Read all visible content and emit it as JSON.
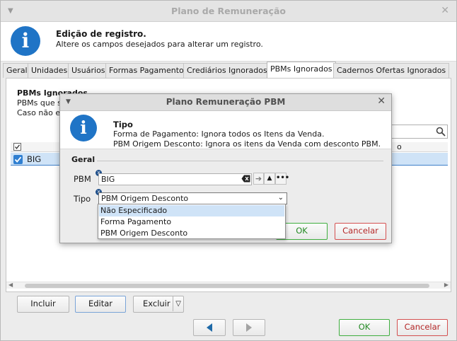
{
  "window": {
    "title": "Plano de Remuneração",
    "menu_glyph": "▼",
    "close_glyph": "✕",
    "header": {
      "icon": "info-icon",
      "icon_glyph": "i",
      "title": "Edição de registro.",
      "subtitle": "Altere os campos desejados para alterar um registro."
    }
  },
  "tabs": [
    {
      "label": "Geral",
      "active": false
    },
    {
      "label": "Unidades",
      "active": false
    },
    {
      "label": "Usuários",
      "active": false
    },
    {
      "label": "Formas Pagamento",
      "active": false
    },
    {
      "label": "Crediários Ignorados",
      "active": false
    },
    {
      "label": "PBMs Ignorados",
      "active": true
    },
    {
      "label": "Cadernos Ofertas Ignorados",
      "active": false
    }
  ],
  "panel": {
    "heading": "PBMs Ignorados",
    "line1": "PBMs que s",
    "line2": "Caso não es",
    "search_icon": "search-icon",
    "column_header_fragment": "o",
    "rows": [
      {
        "checked": true,
        "value": "BIG"
      }
    ]
  },
  "bottom_buttons": {
    "incluir": "Incluir",
    "editar": "Editar",
    "excluir": "Excluir",
    "excluir_arrow": "▽",
    "prev_icon": "arrow-left-icon",
    "next_icon": "arrow-right-icon",
    "ok": "OK",
    "cancelar": "Cancelar"
  },
  "modal": {
    "title": "Plano Remuneração PBM",
    "menu_glyph": "▼",
    "close_glyph": "✕",
    "header": {
      "icon": "info-icon",
      "icon_glyph": "i",
      "title": "Tipo",
      "line1": "Forma de Pagamento: Ignora todos os Itens da Venda.",
      "line2": "PBM Origem Desconto: Ignora os itens da Venda com desconto PBM."
    },
    "group_label": "Geral",
    "pbm_label": "PBM",
    "pbm_value": "BIG",
    "tipo_label": "Tipo",
    "tipo_value": "PBM Origem Desconto",
    "ok": "OK",
    "cancelar": "Cancelar",
    "tipo_options": [
      "Não Especificado",
      "Forma Pagamento",
      "PBM Origem Desconto"
    ],
    "highlighted_option": "Não Especificado"
  },
  "colors": {
    "accent_blue": "#1f74c6",
    "ok_green": "#248a24",
    "cancel_red": "#b42727",
    "selection": "#cfe3f7"
  }
}
